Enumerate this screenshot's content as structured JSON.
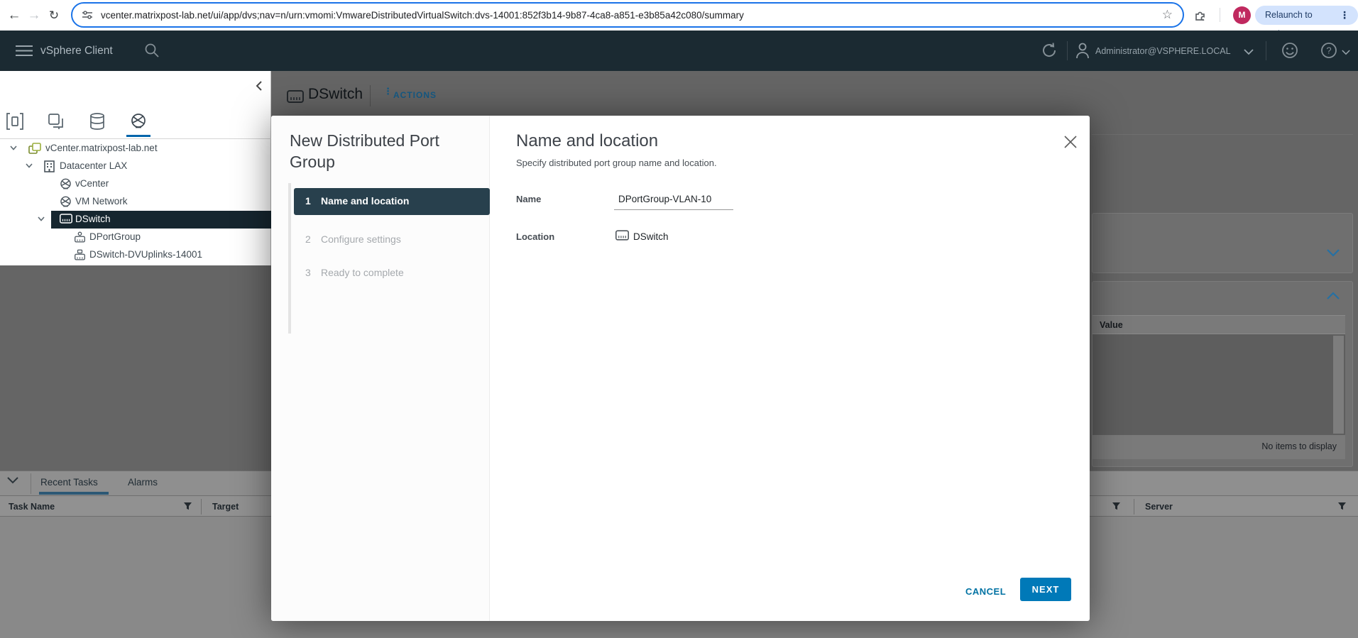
{
  "browser": {
    "url": "vcenter.matrixpost-lab.net/ui/app/dvs;nav=n/urn:vmomi:VmwareDistributedVirtualSwitch:dvs-14001:852f3b14-9b87-4ca8-a851-e3b85a42c080/summary",
    "avatar_letter": "M",
    "relaunch_label": "Relaunch to update"
  },
  "masthead": {
    "app_title": "vSphere Client",
    "user": "Administrator@VSPHERE.LOCAL"
  },
  "object_header": {
    "title": "DSwitch",
    "actions_label": "ACTIONS"
  },
  "sidebar": {
    "tree": [
      {
        "label": "vCenter.matrixpost-lab.net"
      },
      {
        "label": "Datacenter LAX"
      },
      {
        "label": "vCenter"
      },
      {
        "label": "VM Network"
      },
      {
        "label": "DSwitch"
      },
      {
        "label": "DPortGroup"
      },
      {
        "label": "DSwitch-DVUplinks-14001"
      }
    ]
  },
  "dialog": {
    "title": "New Distributed Port Group",
    "steps": [
      {
        "num": "1",
        "label": "Name and location"
      },
      {
        "num": "2",
        "label": "Configure settings"
      },
      {
        "num": "3",
        "label": "Ready to complete"
      }
    ],
    "heading": "Name and location",
    "subheading": "Specify distributed port group name and location.",
    "name_label": "Name",
    "name_value": "DPortGroup-VLAN-10",
    "location_label": "Location",
    "location_value": "DSwitch",
    "cancel_label": "CANCEL",
    "next_label": "NEXT"
  },
  "right_panel": {
    "value_column": "Value",
    "empty_text": "No items to display"
  },
  "tasks_panel": {
    "tabs": [
      {
        "label": "Recent Tasks"
      },
      {
        "label": "Alarms"
      }
    ],
    "columns": [
      {
        "label": "Task Name"
      },
      {
        "label": "Target"
      },
      {
        "label": "Server"
      }
    ]
  },
  "colors": {
    "accent_blue": "#0079b8",
    "masthead_bg": "#1b2a32",
    "active_step_bg": "#28404d"
  }
}
